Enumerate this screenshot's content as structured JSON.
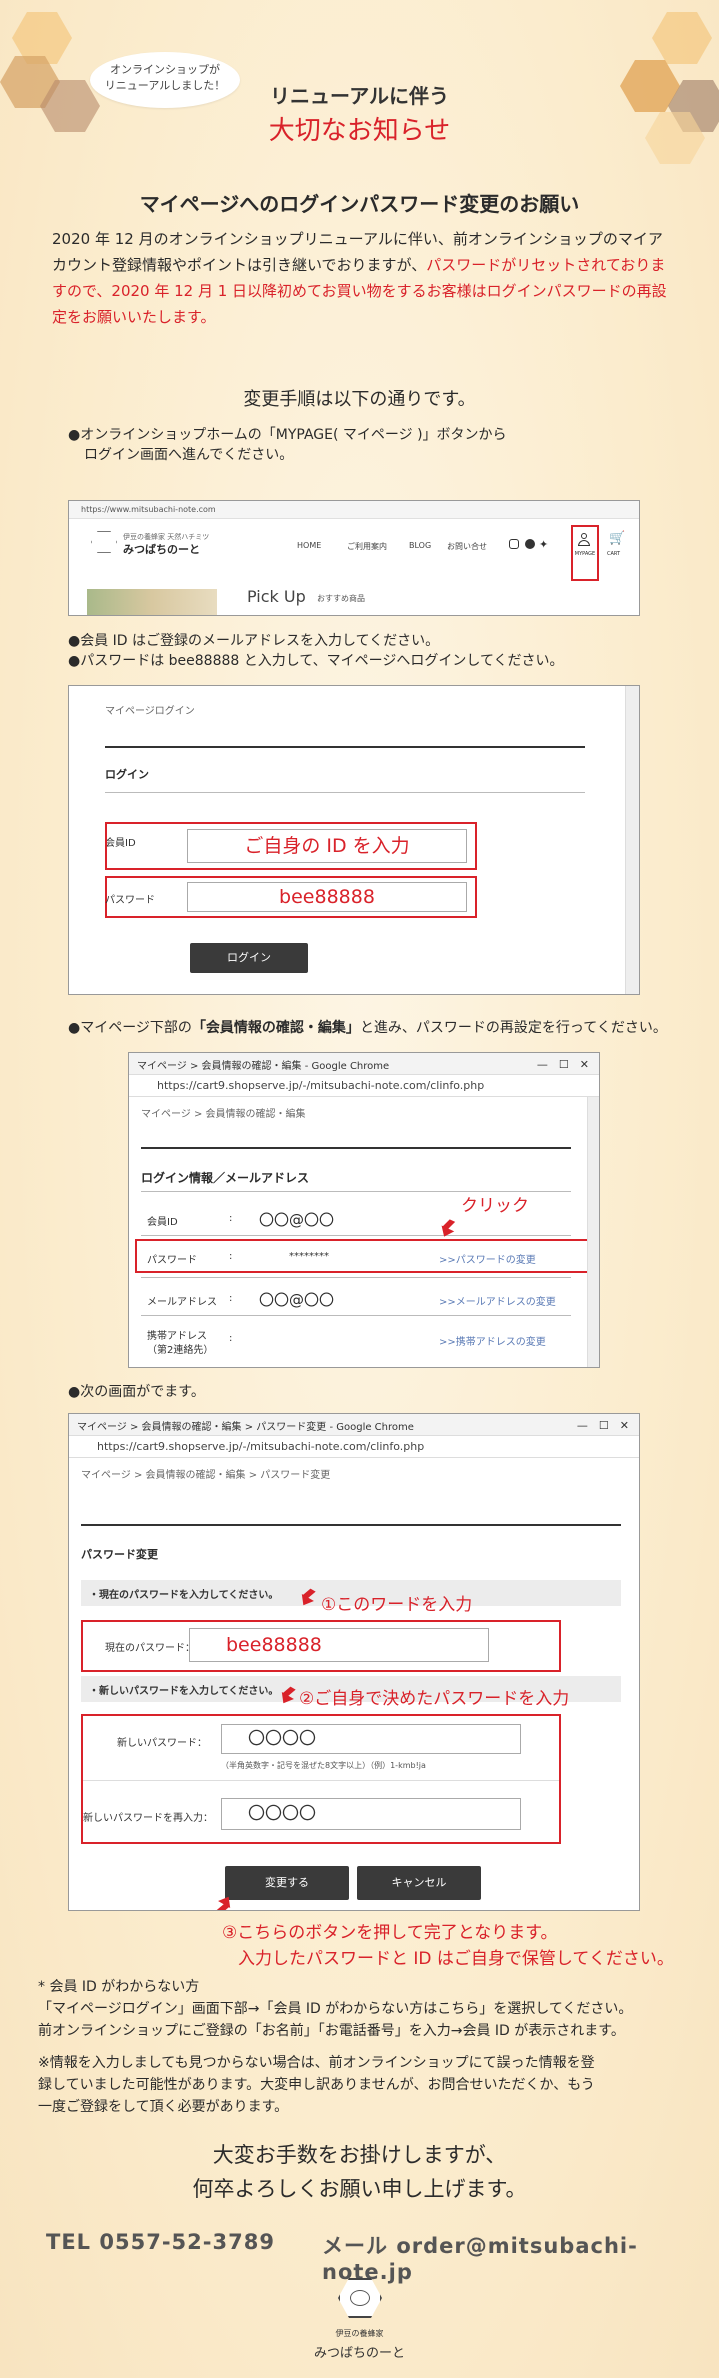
{
  "header": {
    "bubble_line1": "オンラインショップが",
    "bubble_line2": "リニューアルしました！",
    "notice_line1": "リニューアルに伴う",
    "notice_line2": "大切なお知らせ"
  },
  "title": "マイページへのログインパスワード変更のお願い",
  "intro": {
    "part1": "2020 年 12 月のオンラインショップリニューアルに伴い、前オンラインショップのマイアカウント登録情報やポイントは引き継いでおりますが、",
    "part_red": "パスワードがリセットされておりますので、2020 年 12 月 1 日以降初めてお買い物をするお客様はログインパスワードの再設定をお願いいたします。"
  },
  "steps_intro": "変更手順は以下の通りです。",
  "step1": {
    "line1": "●オンラインショップホームの「MYPAGE( マイページ )」ボタンから",
    "line2": "ログイン画面へ進んでください。"
  },
  "shot1": {
    "url": "https://www.mitsubachi-note.com",
    "logo_sub": "伊豆の養蜂家 天然ハチミツ",
    "logo_main": "みつばちのーと",
    "nav": [
      "HOME",
      "ご利用案内",
      "BLOG",
      "お問い合せ"
    ],
    "mypage": "MYPAGE",
    "cart": "CART",
    "pickup": "Pick Up",
    "pickup_sub": "おすすめ商品",
    "icons": [
      "instagram-icon",
      "facebook-icon",
      "twitter-icon",
      "user-icon",
      "cart-icon"
    ]
  },
  "step2": {
    "line1": "●会員 ID はご登録のメールアドレスを入力してください。",
    "line2": "●パスワードは bee88888 と入力して、マイページへログインしてください。"
  },
  "shot2": {
    "breadcrumb": "マイページログイン",
    "heading": "ログイン",
    "id_label": "会員ID",
    "id_value": "ご自身の ID を入力",
    "pw_label": "パスワード",
    "pw_value": "bee88888",
    "button": "ログイン"
  },
  "step3": {
    "prefix": "●マイページ下部の",
    "bold": "「会員情報の確認・編集」",
    "suffix": "と進み、パスワードの再設定を行ってください。"
  },
  "shot3": {
    "window_title": "マイページ > 会員情報の確認・編集 - Google Chrome",
    "url": "https://cart9.shopserve.jp/-/mitsubachi-note.com/clinfo.php",
    "breadcrumb": "マイページ > 会員情報の確認・編集",
    "heading": "ログイン情報／メールアドレス",
    "click": "クリック",
    "rows": [
      {
        "label": "会員ID",
        "colon": ":",
        "value": "〇〇@〇〇",
        "link": ""
      },
      {
        "label": "パスワード",
        "colon": ":",
        "value": "********",
        "link": ">>パスワードの変更"
      },
      {
        "label": "メールアドレス",
        "colon": ":",
        "value": "〇〇@〇〇",
        "link": ">>メールアドレスの変更"
      },
      {
        "label": "携帯アドレス",
        "label2": "（第2連絡先）",
        "colon": ":",
        "value": "",
        "link": ">>携帯アドレスの変更"
      }
    ]
  },
  "step4": "●次の画面がでます。",
  "shot4": {
    "window_title": "マイページ > 会員情報の確認・編集 > パスワード変更 - Google Chrome",
    "url": "https://cart9.shopserve.jp/-/mitsubachi-note.com/clinfo.php",
    "breadcrumb": "マイページ > 会員情報の確認・編集 > パスワード変更",
    "heading": "パスワード変更",
    "band1": "・現在のパスワードを入力してください。",
    "annot1": "①このワードを入力",
    "current_label": "現在のパスワード：",
    "current_value": "bee88888",
    "band2": "・新しいパスワードを入力してください。",
    "annot2": "②ご自身で決めたパスワードを入力",
    "new_label": "新しいパスワード：",
    "new_value": "〇〇〇〇",
    "hint": "（半角英数字・記号を混ぜた8文字以上）（例）1-kmb!ja",
    "confirm_label": "新しいパスワードを再入力：",
    "confirm_value": "〇〇〇〇",
    "submit": "変更する",
    "cancel": "キャンセル"
  },
  "annot3_line1": "③こちらのボタンを押して完了となります。",
  "annot3_line2": "入力したパスワードと ID はご自身で保管してください。",
  "notes": {
    "n1_title": "* 会員 ID がわからない方",
    "n1_l1": "「マイページログイン」画面下部→「会員 ID がわからない方はこちら」を選択してください。",
    "n1_l2": "前オンラインショップにご登録の「お名前」「お電話番号」を入力→会員 ID が表示されます。",
    "n2_l1": "※情報を入力しましても見つからない場合は、前オンラインショップにて誤った情報を登",
    "n2_l2": "録していました可能性があります。大変申し訳ありませんが、お問合せいただくか、もう",
    "n2_l3": "一度ご登録をして頂く必要があります。"
  },
  "closing": {
    "line1": "大変お手数をお掛けしますが、",
    "line2": "何卒よろしくお願い申し上げます。"
  },
  "contact": {
    "tel_label": "TEL",
    "tel": "0557-52-3789",
    "mail_label": "メール",
    "mail": "order@mitsubachi-note.jp"
  },
  "footer": {
    "logo_sub": "伊豆の養蜂家",
    "logo_main": "みつばちのーと"
  },
  "colors": {
    "accent_red": "#d9222a",
    "background": "#fbeed4",
    "honey": "#f0b860"
  }
}
